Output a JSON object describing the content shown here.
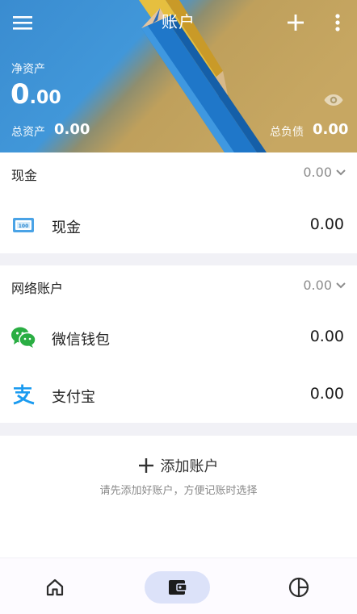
{
  "header": {
    "title": "账户",
    "menu_icon": "menu-icon",
    "add_icon": "plus-icon",
    "more_icon": "more-vert-icon"
  },
  "summary": {
    "net_label": "净资产",
    "net_integer": "0",
    "net_decimal": ".00",
    "visibility_icon": "eye-icon",
    "assets_label": "总资产",
    "assets_value": "0.00",
    "liabilities_label": "总负债",
    "liabilities_value": "0.00"
  },
  "groups": [
    {
      "title": "现金",
      "total": "0.00",
      "accounts": [
        {
          "name": "现金",
          "amount": "0.00",
          "icon": "cash-icon"
        }
      ]
    },
    {
      "title": "网络账户",
      "total": "0.00",
      "accounts": [
        {
          "name": "微信钱包",
          "amount": "0.00",
          "icon": "wechat-icon"
        },
        {
          "name": "支付宝",
          "amount": "0.00",
          "icon": "alipay-icon"
        }
      ]
    }
  ],
  "add_account": {
    "label": "添加账户",
    "hint": "请先添加好账户，方便记账时选择"
  },
  "bottom_nav": [
    {
      "icon": "home-icon",
      "active": false
    },
    {
      "icon": "wallet-icon",
      "active": true
    },
    {
      "icon": "pie-chart-icon",
      "active": false
    }
  ],
  "colors": {
    "accent_pill": "#dce2f9",
    "hero_blue": "#3f97d8",
    "hero_yellow": "#c5a35e",
    "wechat_green": "#2aae43",
    "alipay_blue": "#1b9bf0"
  }
}
